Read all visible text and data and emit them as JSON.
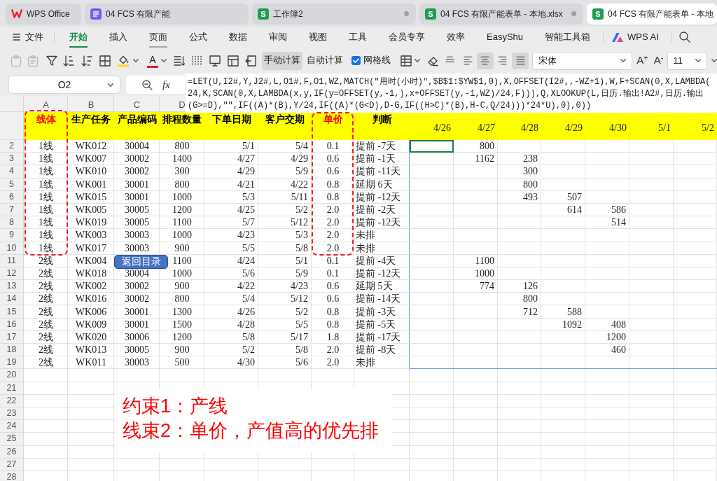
{
  "tabs": [
    {
      "kind": "home",
      "title": "WPS Office",
      "selected": false,
      "modified": false
    },
    {
      "kind": "doc",
      "title": "04 FCS 有限产能",
      "selected": false,
      "modified": false
    },
    {
      "kind": "sheet",
      "icon_letter": "S",
      "title": "工作簿2",
      "selected": false,
      "modified": true
    },
    {
      "kind": "sheet",
      "icon_letter": "S",
      "title": "04 FCS 有限产能表单 - 本地.xlsx",
      "selected": false,
      "modified": true
    },
    {
      "kind": "sheet",
      "icon_letter": "S",
      "title": "04 FCS 有限产能表单 - 本地",
      "selected": true,
      "modified": false
    }
  ],
  "menu": {
    "file_label": "文件",
    "items": [
      {
        "label": "开始",
        "selected": true,
        "hovered": false
      },
      {
        "label": "插入",
        "selected": false,
        "hovered": false
      },
      {
        "label": "页面",
        "selected": false,
        "hovered": true
      },
      {
        "label": "公式",
        "selected": false,
        "hovered": false
      },
      {
        "label": "数据",
        "selected": false,
        "hovered": false
      },
      {
        "label": "审阅",
        "selected": false,
        "hovered": false
      },
      {
        "label": "视图",
        "selected": false,
        "hovered": false
      },
      {
        "label": "工具",
        "selected": false,
        "hovered": false
      },
      {
        "label": "会员专享",
        "selected": false,
        "hovered": false
      },
      {
        "label": "效率",
        "selected": false,
        "hovered": false
      },
      {
        "label": "EasyShu",
        "selected": false,
        "hovered": false
      },
      {
        "label": "智能工具箱",
        "selected": false,
        "hovered": false
      }
    ],
    "ai_label": "WPS AI"
  },
  "toolbar": {
    "font_color_button": "A",
    "calc_modes": [
      {
        "label": "手动计算",
        "selected": true
      },
      {
        "label": "自动计算",
        "selected": false
      }
    ],
    "gridlines": {
      "label": "网格线",
      "checked": true
    },
    "alignment": [
      {
        "kind": "top",
        "selected": false
      },
      {
        "kind": "left",
        "selected": false
      },
      {
        "kind": "center",
        "selected": true
      },
      {
        "kind": "right",
        "selected": false
      },
      {
        "kind": "justify",
        "selected": true
      }
    ],
    "font_name": "宋体",
    "grow_font": "A$^{+}$",
    "shrink_font": "A$^{-}$",
    "font_size": "11"
  },
  "formula_bar": {
    "cell_ref": "O2",
    "fx_label": "fx",
    "formula_lines": [
      "=LET(U,I2#,Y,J2#,L,O1#,F,O1,WZ,MATCH(\"用时(小时)\",$B$1:$YW$1,0),X,OFFSET(I2#,,-WZ+1),W,F+SCAN(0,X,LAMBDA(",
      "24,K,SCAN(0,X,LAMBDA(x,y,IF(y=OFFSET(y,-1,),x+OFFSET(y,-1,WZ)/24,F))),Q,XLOOKUP(L,日历.输出!A2#,日历.输出",
      "(G>=D),\"\",IF((A)*(B),Y/24,IF((A)*(G<D),D-G,IF((H>C)*(B),H-C,Q/24)))*24*U),0),0))"
    ]
  },
  "sheet": {
    "column_headers": [
      "A",
      "B",
      "C",
      "D"
    ],
    "row_headers": [
      "2",
      "3",
      "4",
      "5",
      "6",
      "7",
      "8",
      "9",
      "10",
      "11",
      "12",
      "13",
      "14",
      "15",
      "16",
      "17",
      "18",
      "19",
      "20",
      "21",
      "22",
      "23",
      "24",
      "25",
      "26",
      "27",
      "28"
    ],
    "header_labels": [
      {
        "text": "线体",
        "color": "#ff0000"
      },
      {
        "text": "生产任务",
        "color": "#000000"
      },
      {
        "text": "产品编码",
        "color": "#000000"
      },
      {
        "text": "排程数量",
        "color": "#000000"
      },
      {
        "text": "下单日期",
        "color": "#000000"
      },
      {
        "text": "客户交期",
        "color": "#000000"
      },
      {
        "text": "单价",
        "color": "#ff0000"
      },
      {
        "text": "判断",
        "color": "#000000"
      }
    ],
    "date_headers": [
      "4/26",
      "4/27",
      "4/28",
      "4/29",
      "4/30",
      "5/1",
      "5/2"
    ],
    "rows": [
      {
        "cells": [
          "1线",
          "WK012",
          "30004",
          "800",
          "5/1",
          "5/4",
          "0.1",
          "提前 -7天"
        ],
        "schedule": [
          {
            "selected": true
          },
          {
            "value": "800",
            "selected": false
          },
          {
            "selected": false
          },
          {
            "selected": false
          },
          {
            "selected": false
          },
          {
            "selected": false
          },
          {
            "selected": false
          }
        ]
      },
      {
        "cells": [
          "1线",
          "WK007",
          "30002",
          "1400",
          "4/27",
          "4/29",
          "0.6",
          "提前 -1天"
        ],
        "schedule": [
          {
            "selected": false
          },
          {
            "value": "1162",
            "selected": false
          },
          {
            "value": "238",
            "selected": false
          },
          {
            "selected": false
          },
          {
            "selected": false
          },
          {
            "selected": false
          },
          {
            "selected": false
          }
        ]
      },
      {
        "cells": [
          "1线",
          "WK010",
          "30002",
          "300",
          "4/29",
          "5/9",
          "0.6",
          "提前 -11天"
        ],
        "schedule": [
          {
            "selected": false
          },
          {
            "selected": false
          },
          {
            "value": "300",
            "selected": false
          },
          {
            "selected": false
          },
          {
            "selected": false
          },
          {
            "selected": false
          },
          {
            "selected": false
          }
        ]
      },
      {
        "cells": [
          "1线",
          "WK001",
          "30001",
          "800",
          "4/21",
          "4/22",
          "0.8",
          "延期 6天"
        ],
        "schedule": [
          {
            "selected": false
          },
          {
            "selected": false
          },
          {
            "value": "800",
            "selected": false
          },
          {
            "selected": false
          },
          {
            "selected": false
          },
          {
            "selected": false
          },
          {
            "selected": false
          }
        ]
      },
      {
        "cells": [
          "1线",
          "WK015",
          "30001",
          "1000",
          "5/3",
          "5/11",
          "0.8",
          "提前 -12天"
        ],
        "schedule": [
          {
            "selected": false
          },
          {
            "selected": false
          },
          {
            "value": "493",
            "selected": false
          },
          {
            "value": "507",
            "selected": false
          },
          {
            "selected": false
          },
          {
            "selected": false
          },
          {
            "selected": false
          }
        ]
      },
      {
        "cells": [
          "1线",
          "WK005",
          "30005",
          "1200",
          "4/25",
          "5/2",
          "2.0",
          "提前 -2天"
        ],
        "schedule": [
          {
            "selected": false
          },
          {
            "selected": false
          },
          {
            "selected": false
          },
          {
            "value": "614",
            "selected": false
          },
          {
            "value": "586",
            "selected": false
          },
          {
            "selected": false
          },
          {
            "selected": false
          }
        ]
      },
      {
        "cells": [
          "1线",
          "WK019",
          "30005",
          "1100",
          "5/7",
          "5/12",
          "2.0",
          "提前 -12天"
        ],
        "schedule": [
          {
            "selected": false
          },
          {
            "selected": false
          },
          {
            "selected": false
          },
          {
            "selected": false
          },
          {
            "value": "514",
            "selected": false
          },
          {
            "selected": false
          },
          {
            "selected": false
          }
        ]
      },
      {
        "cells": [
          "1线",
          "WK003",
          "30003",
          "1000",
          "4/23",
          "5/3",
          "2.0",
          "未排"
        ],
        "schedule": [
          {
            "selected": false
          },
          {
            "selected": false
          },
          {
            "selected": false
          },
          {
            "selected": false
          },
          {
            "selected": false
          },
          {
            "selected": false
          },
          {
            "selected": false
          }
        ]
      },
      {
        "cells": [
          "1线",
          "WK017",
          "30003",
          "900",
          "5/5",
          "5/8",
          "2.0",
          "未排"
        ],
        "schedule": [
          {
            "selected": false
          },
          {
            "selected": false
          },
          {
            "selected": false
          },
          {
            "selected": false
          },
          {
            "selected": false
          },
          {
            "selected": false
          },
          {
            "selected": false
          }
        ]
      },
      {
        "cells": [
          "2线",
          "WK004",
          null,
          "1100",
          "4/24",
          "5/1",
          "0.1",
          "提前 -4天"
        ],
        "schedule": [
          {
            "selected": false
          },
          {
            "value": "1100",
            "selected": false
          },
          {
            "selected": false
          },
          {
            "selected": false
          },
          {
            "selected": false
          },
          {
            "selected": false
          },
          {
            "selected": false
          }
        ]
      },
      {
        "cells": [
          "2线",
          "WK018",
          "30004",
          "1000",
          "5/6",
          "5/9",
          "0.1",
          "提前 -12天"
        ],
        "schedule": [
          {
            "selected": false
          },
          {
            "value": "1000",
            "selected": false
          },
          {
            "selected": false
          },
          {
            "selected": false
          },
          {
            "selected": false
          },
          {
            "selected": false
          },
          {
            "selected": false
          }
        ]
      },
      {
        "cells": [
          "2线",
          "WK002",
          "30002",
          "900",
          "4/22",
          "4/23",
          "0.6",
          "延期 5天"
        ],
        "schedule": [
          {
            "selected": false
          },
          {
            "value": "774",
            "selected": false
          },
          {
            "value": "126",
            "selected": false
          },
          {
            "selected": false
          },
          {
            "selected": false
          },
          {
            "selected": false
          },
          {
            "selected": false
          }
        ]
      },
      {
        "cells": [
          "2线",
          "WK016",
          "30002",
          "800",
          "5/4",
          "5/12",
          "0.6",
          "提前 -14天"
        ],
        "schedule": [
          {
            "selected": false
          },
          {
            "selected": false
          },
          {
            "value": "800",
            "selected": false
          },
          {
            "selected": false
          },
          {
            "selected": false
          },
          {
            "selected": false
          },
          {
            "selected": false
          }
        ]
      },
      {
        "cells": [
          "2线",
          "WK006",
          "30001",
          "1300",
          "4/26",
          "5/2",
          "0.8",
          "提前 -3天"
        ],
        "schedule": [
          {
            "selected": false
          },
          {
            "selected": false
          },
          {
            "value": "712",
            "selected": false
          },
          {
            "value": "588",
            "selected": false
          },
          {
            "selected": false
          },
          {
            "selected": false
          },
          {
            "selected": false
          }
        ]
      },
      {
        "cells": [
          "2线",
          "WK009",
          "30001",
          "1500",
          "4/28",
          "5/5",
          "0.8",
          "提前 -5天"
        ],
        "schedule": [
          {
            "selected": false
          },
          {
            "selected": false
          },
          {
            "selected": false
          },
          {
            "value": "1092",
            "selected": false
          },
          {
            "value": "408",
            "selected": false
          },
          {
            "selected": false
          },
          {
            "selected": false
          }
        ]
      },
      {
        "cells": [
          "2线",
          "WK020",
          "30006",
          "1200",
          "5/8",
          "5/17",
          "1.8",
          "提前 -17天"
        ],
        "schedule": [
          {
            "selected": false
          },
          {
            "selected": false
          },
          {
            "selected": false
          },
          {
            "selected": false
          },
          {
            "value": "1200",
            "selected": false
          },
          {
            "selected": false
          },
          {
            "selected": false
          }
        ]
      },
      {
        "cells": [
          "2线",
          "WK013",
          "30005",
          "900",
          "5/2",
          "5/8",
          "2.0",
          "提前 -8天"
        ],
        "schedule": [
          {
            "selected": false
          },
          {
            "selected": false
          },
          {
            "selected": false
          },
          {
            "selected": false
          },
          {
            "value": "460",
            "selected": false
          },
          {
            "selected": false
          },
          {
            "selected": false
          }
        ]
      },
      {
        "cells": [
          "2线",
          "WK011",
          "30003",
          "500",
          "4/30",
          "5/6",
          "2.0",
          "未排"
        ],
        "schedule": [
          {
            "selected": false
          },
          {
            "selected": false
          },
          {
            "selected": false
          },
          {
            "selected": false
          },
          {
            "selected": false
          },
          {
            "selected": false
          },
          {
            "selected": false
          }
        ]
      }
    ]
  },
  "return_button": {
    "label": "返回目录"
  },
  "notes": [
    "约束1：产线",
    "线束2：单价，产值高的优先排"
  ]
}
